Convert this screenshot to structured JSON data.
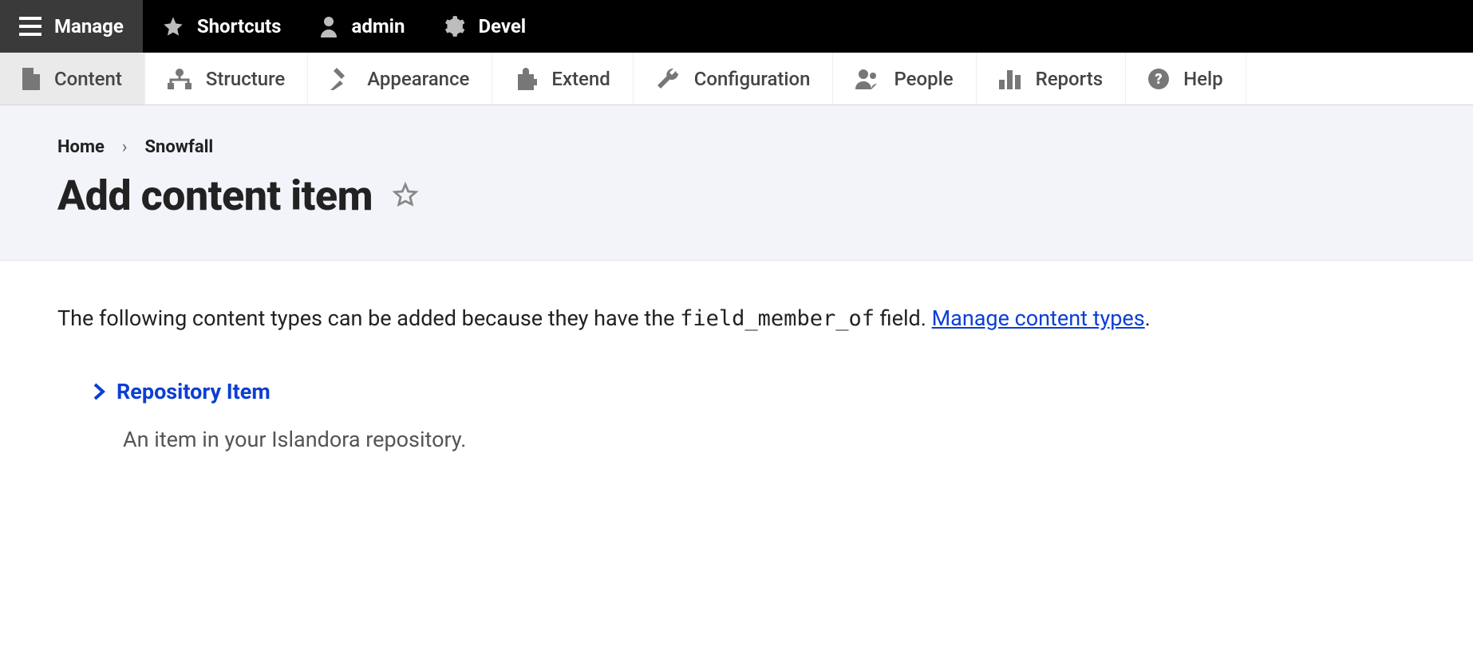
{
  "toolbar_top": {
    "manage": "Manage",
    "shortcuts": "Shortcuts",
    "admin": "admin",
    "devel": "Devel"
  },
  "toolbar_sub": {
    "content": "Content",
    "structure": "Structure",
    "appearance": "Appearance",
    "extend": "Extend",
    "configuration": "Configuration",
    "people": "People",
    "reports": "Reports",
    "help": "Help"
  },
  "breadcrumb": {
    "home": "Home",
    "sep": "›",
    "current": "Snowfall"
  },
  "page_title": "Add content item",
  "intro": {
    "prefix": "The following content types can be added because they have the ",
    "code": "field_member_of",
    "suffix": " field. ",
    "link": "Manage content types",
    "period": "."
  },
  "types": [
    {
      "label": "Repository Item",
      "description": "An item in your Islandora repository."
    }
  ]
}
